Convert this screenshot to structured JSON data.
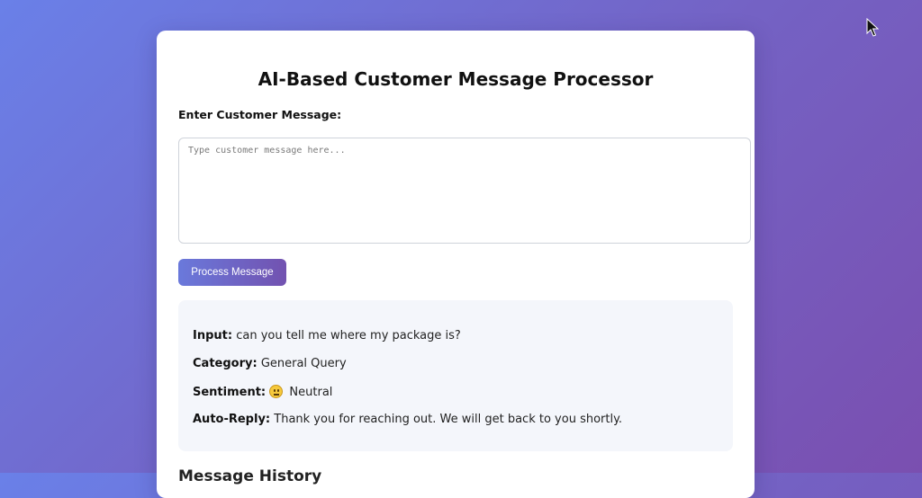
{
  "app": {
    "title": "AI-Based Customer Message Processor"
  },
  "form": {
    "label": "Enter Customer Message:",
    "input_value": "",
    "placeholder": "Type customer message here...",
    "button_label": "Process Message"
  },
  "result": {
    "input_label": "Input:",
    "input_value": "can you tell me where my package is?",
    "category_label": "Category:",
    "category_value": "General Query",
    "sentiment_label": "Sentiment:",
    "sentiment_icon": "neutral-face-emoji",
    "sentiment_value": "Neutral",
    "reply_label": "Auto-Reply:",
    "reply_value": "Thank you for reaching out. We will get back to you shortly."
  },
  "history": {
    "heading": "Message History"
  },
  "colors": {
    "background_start": "#6a80e8",
    "background_end": "#7a4fb0",
    "button_start": "#6a79db",
    "button_end": "#7252b0",
    "result_bg": "#f4f6fb"
  }
}
